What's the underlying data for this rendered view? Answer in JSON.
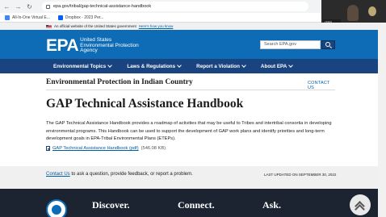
{
  "browser": {
    "url": "epa.gov/tribal/gap-technical-assistance-handbook",
    "bookmarks": [
      {
        "label": "All-In-One Virtual E...",
        "color": "#4285f4"
      },
      {
        "label": "Dropbox - 2023 Per...",
        "color": "#0061fe"
      }
    ]
  },
  "video": {
    "name": "ITEP Events 1"
  },
  "gov_banner": {
    "text": "An official website of the United States government",
    "link": "Here's how you know"
  },
  "header": {
    "logo_mark": "EPA",
    "logo_text": "United States Environmental Protection Agency",
    "search_placeholder": "Search EPA.gov"
  },
  "nav": [
    {
      "label": "Environmental Topics"
    },
    {
      "label": "Laws & Regulations"
    },
    {
      "label": "Report a Violation"
    },
    {
      "label": "About EPA"
    }
  ],
  "main": {
    "section_title": "Environmental Protection in Indian Country",
    "contact_link": "CONTACT US",
    "title": "GAP Technical Assistance Handbook",
    "intro": "The GAP Technical Assistance Handbook provides a roadmap of activities that may be useful to Tribes and intertribal consortia in developing environmental programs. This Handbook can be used to support the development of GAP work plans and identify priorities and long-term development goals in EPA-Tribal Environmental Plans (ETEPs).",
    "pdf_link": "GAP Technical Assistance Handbook (pdf)",
    "pdf_size": "(546.08 KB)"
  },
  "contact_strip": {
    "link": "Contact Us",
    "text": "to ask a question, provide feedback, or report a problem.",
    "updated": "LAST UPDATED ON SEPTEMBER 30, 2022"
  },
  "footer": {
    "headings": [
      "Discover.",
      "Connect.",
      "Ask."
    ]
  },
  "colors": {
    "epa_blue": "#0e6cb6",
    "nav_navy": "#1a4480",
    "link": "#005ea2",
    "footer": "#1b2430"
  }
}
